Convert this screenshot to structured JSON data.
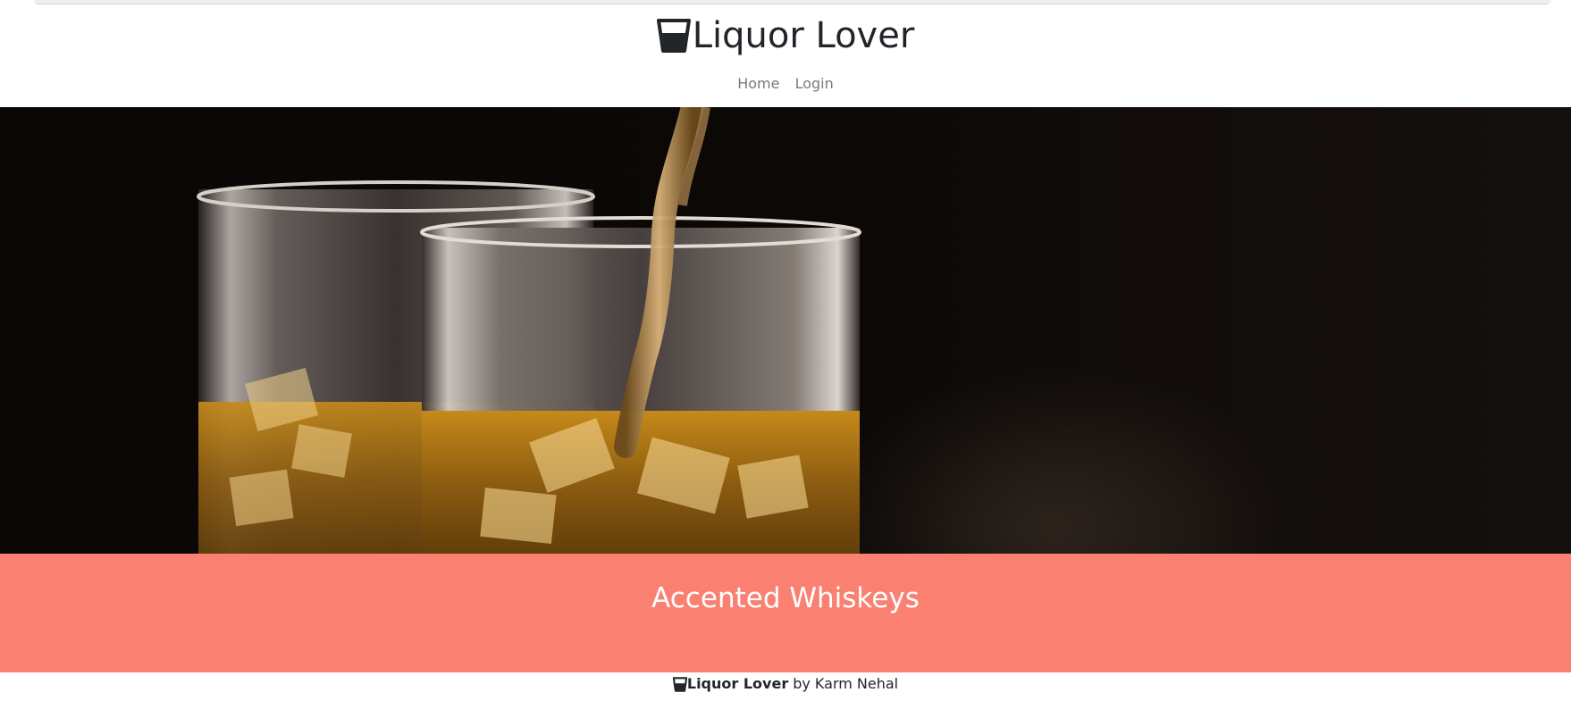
{
  "header": {
    "brand_name": "Liquor Lover",
    "brand_icon": "glass-icon",
    "nav": [
      {
        "label": "Home"
      },
      {
        "label": "Login"
      }
    ]
  },
  "hero": {
    "image_subject": "whiskey being poured into two glasses with ice"
  },
  "banner": {
    "title": "Accented Whiskeys",
    "color": "#fa8072"
  },
  "footer": {
    "brand_name": "Liquor Lover",
    "credit": "by Karm Nehal"
  }
}
